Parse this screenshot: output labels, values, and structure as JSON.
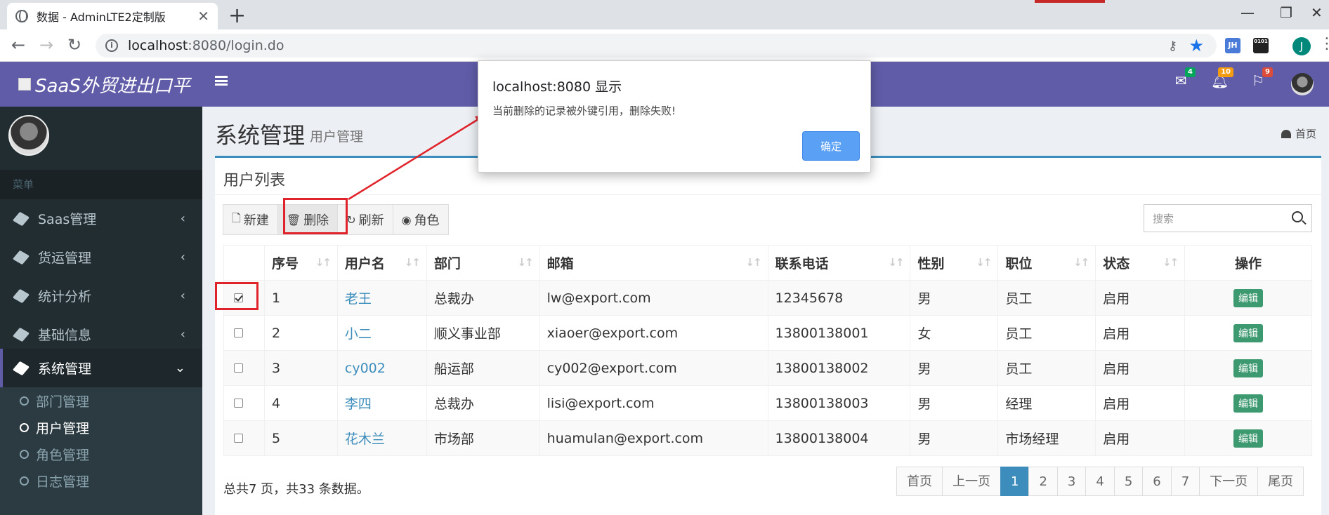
{
  "browser": {
    "tab_title": "数据 - AdminLTE2定制版",
    "url_host": "localhost",
    "url_path": ":8080/login.do",
    "ext1": "JH",
    "ext2": "0101",
    "profile_initial": "J"
  },
  "sidebar": {
    "logo": "SaaS外贸进出口平",
    "menu_header": "菜单",
    "items": [
      {
        "label": "Saas管理"
      },
      {
        "label": "货运管理"
      },
      {
        "label": "统计分析"
      },
      {
        "label": "基础信息"
      },
      {
        "label": "系统管理"
      }
    ],
    "sub_items": [
      {
        "label": "部门管理"
      },
      {
        "label": "用户管理"
      },
      {
        "label": "角色管理"
      },
      {
        "label": "日志管理"
      }
    ]
  },
  "topnav": {
    "mail_count": "4",
    "bell_count": "10",
    "flag_count": "9",
    "badge_colors": {
      "mail": "#00a65a",
      "bell": "#f39c12",
      "flag": "#dd4b39"
    }
  },
  "content": {
    "title": "系统管理",
    "subtitle": "用户管理",
    "breadcrumb": "首页",
    "box_title": "用户列表",
    "toolbar": {
      "new": "新建",
      "delete": "删除",
      "refresh": "刷新",
      "role": "角色"
    },
    "search_placeholder": "搜索",
    "columns": [
      "序号",
      "用户名",
      "部门",
      "邮箱",
      "联系电话",
      "性别",
      "职位",
      "状态",
      "操作"
    ],
    "rows": [
      {
        "checked": true,
        "no": "1",
        "name": "老王",
        "dept": "总裁办",
        "email": "lw@export.com",
        "phone": "12345678",
        "gender": "男",
        "position": "员工",
        "status": "启用",
        "action": "编辑"
      },
      {
        "checked": false,
        "no": "2",
        "name": "小二",
        "dept": "顺义事业部",
        "email": "xiaoer@export.com",
        "phone": "13800138001",
        "gender": "女",
        "position": "员工",
        "status": "启用",
        "action": "编辑"
      },
      {
        "checked": false,
        "no": "3",
        "name": "cy002",
        "dept": "船运部",
        "email": "cy002@export.com",
        "phone": "13800138002",
        "gender": "男",
        "position": "员工",
        "status": "启用",
        "action": "编辑"
      },
      {
        "checked": false,
        "no": "4",
        "name": "李四",
        "dept": "总裁办",
        "email": "lisi@export.com",
        "phone": "13800138003",
        "gender": "男",
        "position": "经理",
        "status": "启用",
        "action": "编辑"
      },
      {
        "checked": false,
        "no": "5",
        "name": "花木兰",
        "dept": "市场部",
        "email": "huamulan@export.com",
        "phone": "13800138004",
        "gender": "男",
        "position": "市场经理",
        "status": "启用",
        "action": "编辑"
      }
    ],
    "footer_text": "总共7 页，共33 条数据。",
    "pagination": [
      "首页",
      "上一页",
      "1",
      "2",
      "3",
      "4",
      "5",
      "6",
      "7",
      "下一页",
      "尾页"
    ],
    "current_page": "1"
  },
  "dialog": {
    "title": "localhost:8080 显示",
    "message": "当前删除的记录被外键引用，删除失败!",
    "ok": "确定"
  }
}
